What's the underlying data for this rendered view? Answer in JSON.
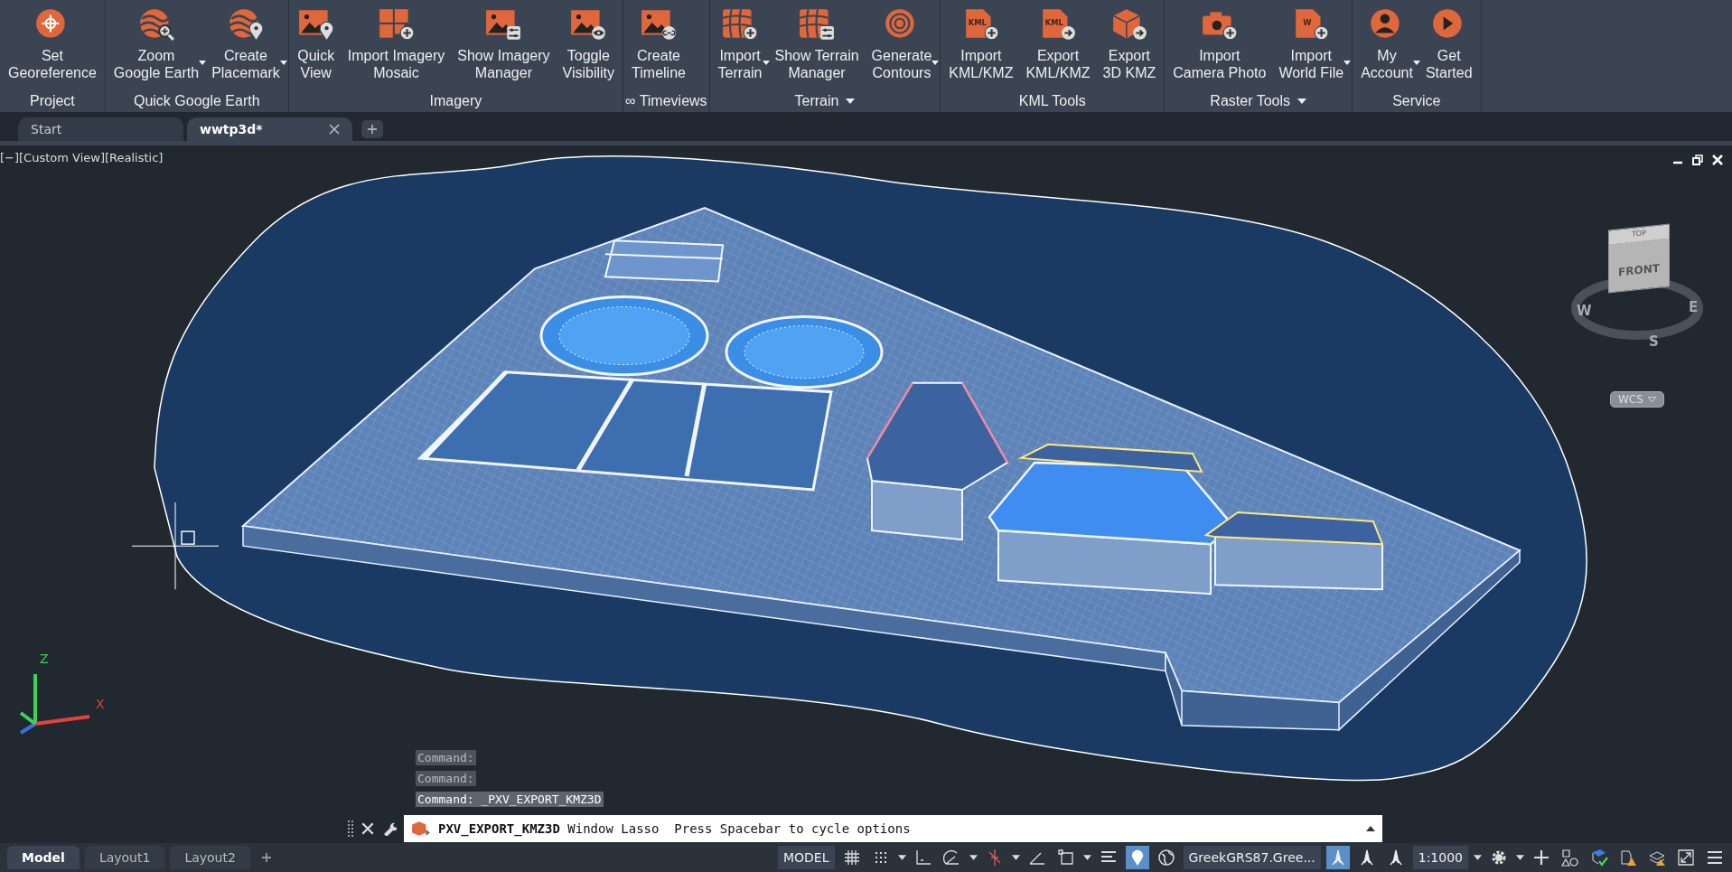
{
  "ribbon": {
    "panels": [
      {
        "title": "Project",
        "title_dropdown": false,
        "buttons": [
          {
            "lines": [
              "Set",
              "Georeference"
            ],
            "dropdown": false
          }
        ]
      },
      {
        "title": "Quick Google Earth",
        "title_dropdown": false,
        "buttons": [
          {
            "lines": [
              "Zoom",
              "Google Earth"
            ],
            "dropdown": true
          },
          {
            "lines": [
              "Create",
              "Placemark"
            ],
            "dropdown": true
          }
        ]
      },
      {
        "title": "Imagery",
        "title_dropdown": false,
        "buttons": [
          {
            "lines": [
              "Quick",
              "View"
            ],
            "dropdown": false
          },
          {
            "lines": [
              "Import Imagery",
              "Mosaic"
            ],
            "dropdown": false
          },
          {
            "lines": [
              "Show Imagery",
              "Manager"
            ],
            "dropdown": false
          },
          {
            "lines": [
              "Toggle",
              "Visibility"
            ],
            "dropdown": false
          }
        ]
      },
      {
        "title": "∞ Timeviews",
        "title_dropdown": false,
        "buttons": [
          {
            "lines": [
              "Create",
              "Timeline"
            ],
            "dropdown": false
          }
        ]
      },
      {
        "title": "Terrain",
        "title_dropdown": true,
        "buttons": [
          {
            "lines": [
              "Import",
              "Terrain"
            ],
            "dropdown": true
          },
          {
            "lines": [
              "Show Terrain",
              "Manager"
            ],
            "dropdown": false
          },
          {
            "lines": [
              "Generate",
              "Contours"
            ],
            "dropdown": true
          }
        ]
      },
      {
        "title": "KML Tools",
        "title_dropdown": false,
        "buttons": [
          {
            "lines": [
              "Import",
              "KML/KMZ"
            ],
            "dropdown": false,
            "icon_text": "KML"
          },
          {
            "lines": [
              "Export",
              "KML/KMZ"
            ],
            "dropdown": false,
            "icon_text": "KML"
          },
          {
            "lines": [
              "Export",
              "3D KMZ"
            ],
            "dropdown": false
          }
        ]
      },
      {
        "title": "Raster Tools",
        "title_dropdown": true,
        "buttons": [
          {
            "lines": [
              "Import",
              "Camera Photo"
            ],
            "dropdown": false
          },
          {
            "lines": [
              "Import",
              "World File"
            ],
            "dropdown": true,
            "icon_text": "W"
          }
        ]
      },
      {
        "title": "Service",
        "title_dropdown": false,
        "buttons": [
          {
            "lines": [
              "My",
              "Account"
            ],
            "dropdown": true
          },
          {
            "lines": [
              "Get",
              "Started"
            ],
            "dropdown": false
          }
        ]
      }
    ]
  },
  "file_tabs": [
    {
      "label": "Start",
      "selected": false,
      "closable": false
    },
    {
      "label": "wwtp3d*",
      "selected": true,
      "closable": true
    }
  ],
  "viewport": {
    "controls": [
      "[−]",
      "[Custom View]",
      "[Realistic]"
    ],
    "viewcube": {
      "top": "TOP",
      "front": "FRONT",
      "compass": [
        "W",
        "S",
        "E"
      ],
      "ucs_menu": "WCS"
    },
    "ucs_axes": [
      "Z",
      "X"
    ]
  },
  "command_history": [
    {
      "text": "Command:",
      "current": false
    },
    {
      "text": "Command:",
      "current": false
    },
    {
      "text": "Command: _PXV_EXPORT_KMZ3D",
      "current": true
    }
  ],
  "command_line": {
    "prompt": "**PXV_EXPORT_KMZ3D** Window Lasso  Press Spacebar to cycle options"
  },
  "layout_tabs": [
    {
      "label": "Model",
      "selected": true
    },
    {
      "label": "Layout1",
      "selected": false
    },
    {
      "label": "Layout2",
      "selected": false
    }
  ],
  "status_bar": [
    {
      "kind": "text",
      "text": "MODEL",
      "active": false
    },
    {
      "kind": "icon",
      "active": false
    },
    {
      "kind": "icon",
      "active": false
    },
    {
      "kind": "caret",
      "active": false
    },
    {
      "kind": "icon",
      "active": false
    },
    {
      "kind": "icon",
      "active": false
    },
    {
      "kind": "caret",
      "active": false
    },
    {
      "kind": "icon",
      "active": false
    },
    {
      "kind": "caret",
      "active": false
    },
    {
      "kind": "icon",
      "active": false
    },
    {
      "kind": "icon",
      "active": false
    },
    {
      "kind": "caret",
      "active": false
    },
    {
      "kind": "icon",
      "active": false
    },
    {
      "kind": "icon",
      "active": true
    },
    {
      "kind": "icon",
      "active": false
    },
    {
      "kind": "text",
      "text": "GreekGRS87.Gree...",
      "active": false
    },
    {
      "kind": "icon",
      "active": true
    },
    {
      "kind": "icon",
      "active": false
    },
    {
      "kind": "icon",
      "active": false
    },
    {
      "kind": "text",
      "text": "1:1000",
      "active": false
    },
    {
      "kind": "caret",
      "active": false
    },
    {
      "kind": "icon",
      "active": false
    },
    {
      "kind": "caret",
      "active": false
    },
    {
      "kind": "icon",
      "active": false
    },
    {
      "kind": "icon",
      "active": false
    },
    {
      "kind": "icon",
      "active": false
    },
    {
      "kind": "icon",
      "active": false
    },
    {
      "kind": "icon",
      "active": false
    },
    {
      "kind": "icon",
      "active": false
    },
    {
      "kind": "icon",
      "active": false
    }
  ]
}
